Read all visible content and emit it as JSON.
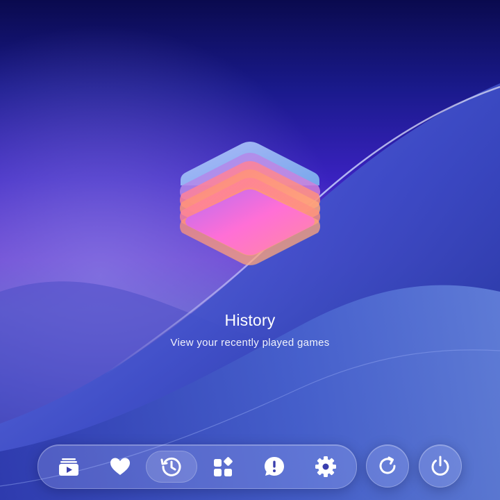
{
  "hero": {
    "icon": "history-stack-icon",
    "title": "History",
    "subtitle": "View your recently played games"
  },
  "dock": {
    "items": [
      {
        "icon": "play-library-icon",
        "active": false
      },
      {
        "icon": "heart-icon",
        "active": false
      },
      {
        "icon": "history-icon",
        "active": true
      },
      {
        "icon": "apps-grid-icon",
        "active": false
      },
      {
        "icon": "feedback-icon",
        "active": false
      },
      {
        "icon": "gear-icon",
        "active": false
      }
    ]
  },
  "system_buttons": [
    {
      "icon": "refresh-icon"
    },
    {
      "icon": "power-icon"
    }
  ],
  "colors": {
    "background_top": "#0a0a4e",
    "background_mid": "#6a3fd0",
    "background_bottom": "#1d2a8a",
    "icon": "#ffffff"
  }
}
